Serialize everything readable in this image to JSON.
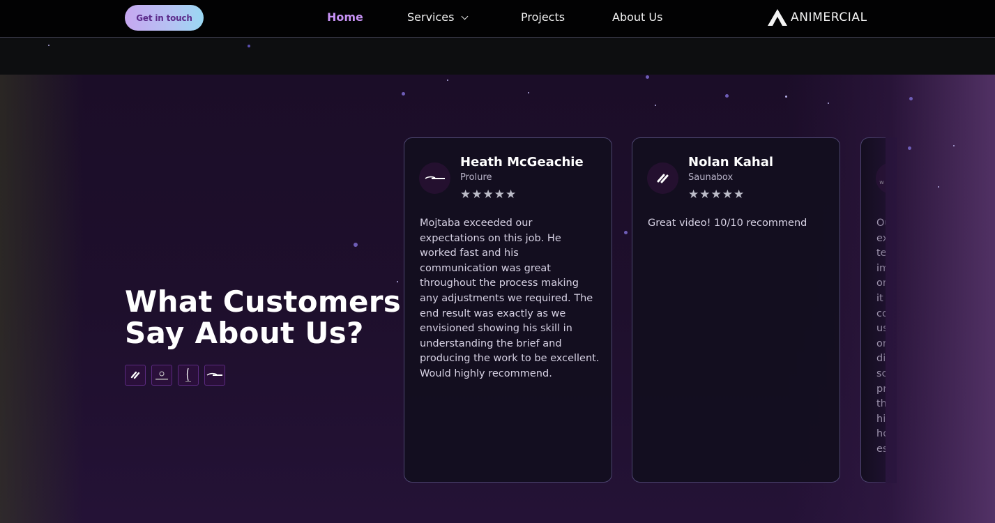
{
  "navbar": {
    "cta_label": "Get in touch",
    "items": [
      {
        "label": "Home",
        "active": true
      },
      {
        "label": "Services",
        "active": false
      },
      {
        "label": "Projects",
        "active": false
      },
      {
        "label": "About Us",
        "active": false
      }
    ],
    "brand": "ANIMERCIAL"
  },
  "testimonials": {
    "heading_line1": "What Customers",
    "heading_line2": "Say About Us?",
    "client_logos": [
      "saunabox-logo",
      "winks-logo",
      "gallery-logo",
      "prolure-logo"
    ],
    "cards": [
      {
        "name": "Heath McGeachie",
        "company": "Prolure",
        "rating": 5,
        "stars": "★★★★★",
        "text": "Mojtaba exceeded our expectations on this job. He worked fast and his communication was great throughout the process making any adjustments we required. The end result was exactly as we envisioned showing his skill in understanding the brief and producing the work to be excellent. Would highly recommend."
      },
      {
        "name": "Nolan Kahal",
        "company": "Saunabox",
        "rating": 5,
        "stars": "★★★★★",
        "text": "Great video! 10/10 recommend"
      }
    ],
    "partial_card_fragments": [
      "Ou",
      "ex",
      "te",
      "im",
      "on",
      "it",
      "co",
      "us",
      "on",
      "di",
      "sc",
      "pr",
      "th",
      "hi",
      "ho",
      "es"
    ]
  },
  "colors": {
    "accent": "#c792f5",
    "cta_gradient_start": "#c6a7f0",
    "cta_gradient_end": "#9ad8f3",
    "card_border": "#4d4670"
  }
}
